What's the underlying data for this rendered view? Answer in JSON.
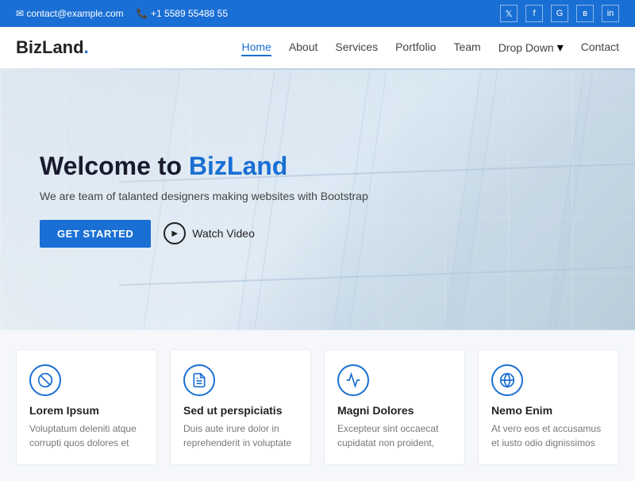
{
  "topbar": {
    "email": "contact@example.com",
    "phone": "+1 5589 55488 55",
    "email_icon": "✉",
    "phone_icon": "📞",
    "social": [
      {
        "name": "twitter",
        "icon": "𝕏"
      },
      {
        "name": "facebook",
        "icon": "f"
      },
      {
        "name": "google",
        "icon": "G"
      },
      {
        "name": "vk",
        "icon": "в"
      },
      {
        "name": "linkedin",
        "icon": "in"
      }
    ]
  },
  "navbar": {
    "logo": "BizLand",
    "logo_dot": ".",
    "links": [
      {
        "label": "Home",
        "active": true
      },
      {
        "label": "About",
        "active": false
      },
      {
        "label": "Services",
        "active": false
      },
      {
        "label": "Portfolio",
        "active": false
      },
      {
        "label": "Team",
        "active": false
      },
      {
        "label": "Drop Down",
        "active": false,
        "dropdown": true
      },
      {
        "label": "Contact",
        "active": false
      }
    ]
  },
  "hero": {
    "title_prefix": "Welcome to ",
    "title_accent": "BizLand",
    "subtitle": "We are team of talanted designers making websites with Bootstrap",
    "btn_get_started": "GET STARTED",
    "btn_watch_video": "Watch Video"
  },
  "features": [
    {
      "icon": "🏀",
      "title": "Lorem Ipsum",
      "desc": "Voluptatum deleniti atque corrupti quos dolores et"
    },
    {
      "icon": "📄",
      "title": "Sed ut perspiciatis",
      "desc": "Duis aute irure dolor in reprehenderit in voluptate"
    },
    {
      "icon": "⏱",
      "title": "Magni Dolores",
      "desc": "Excepteur sint occaecat cupidatat non proident,"
    },
    {
      "icon": "🌐",
      "title": "Nemo Enim",
      "desc": "At vero eos et accusamus et iusto odio dignissimos"
    }
  ]
}
